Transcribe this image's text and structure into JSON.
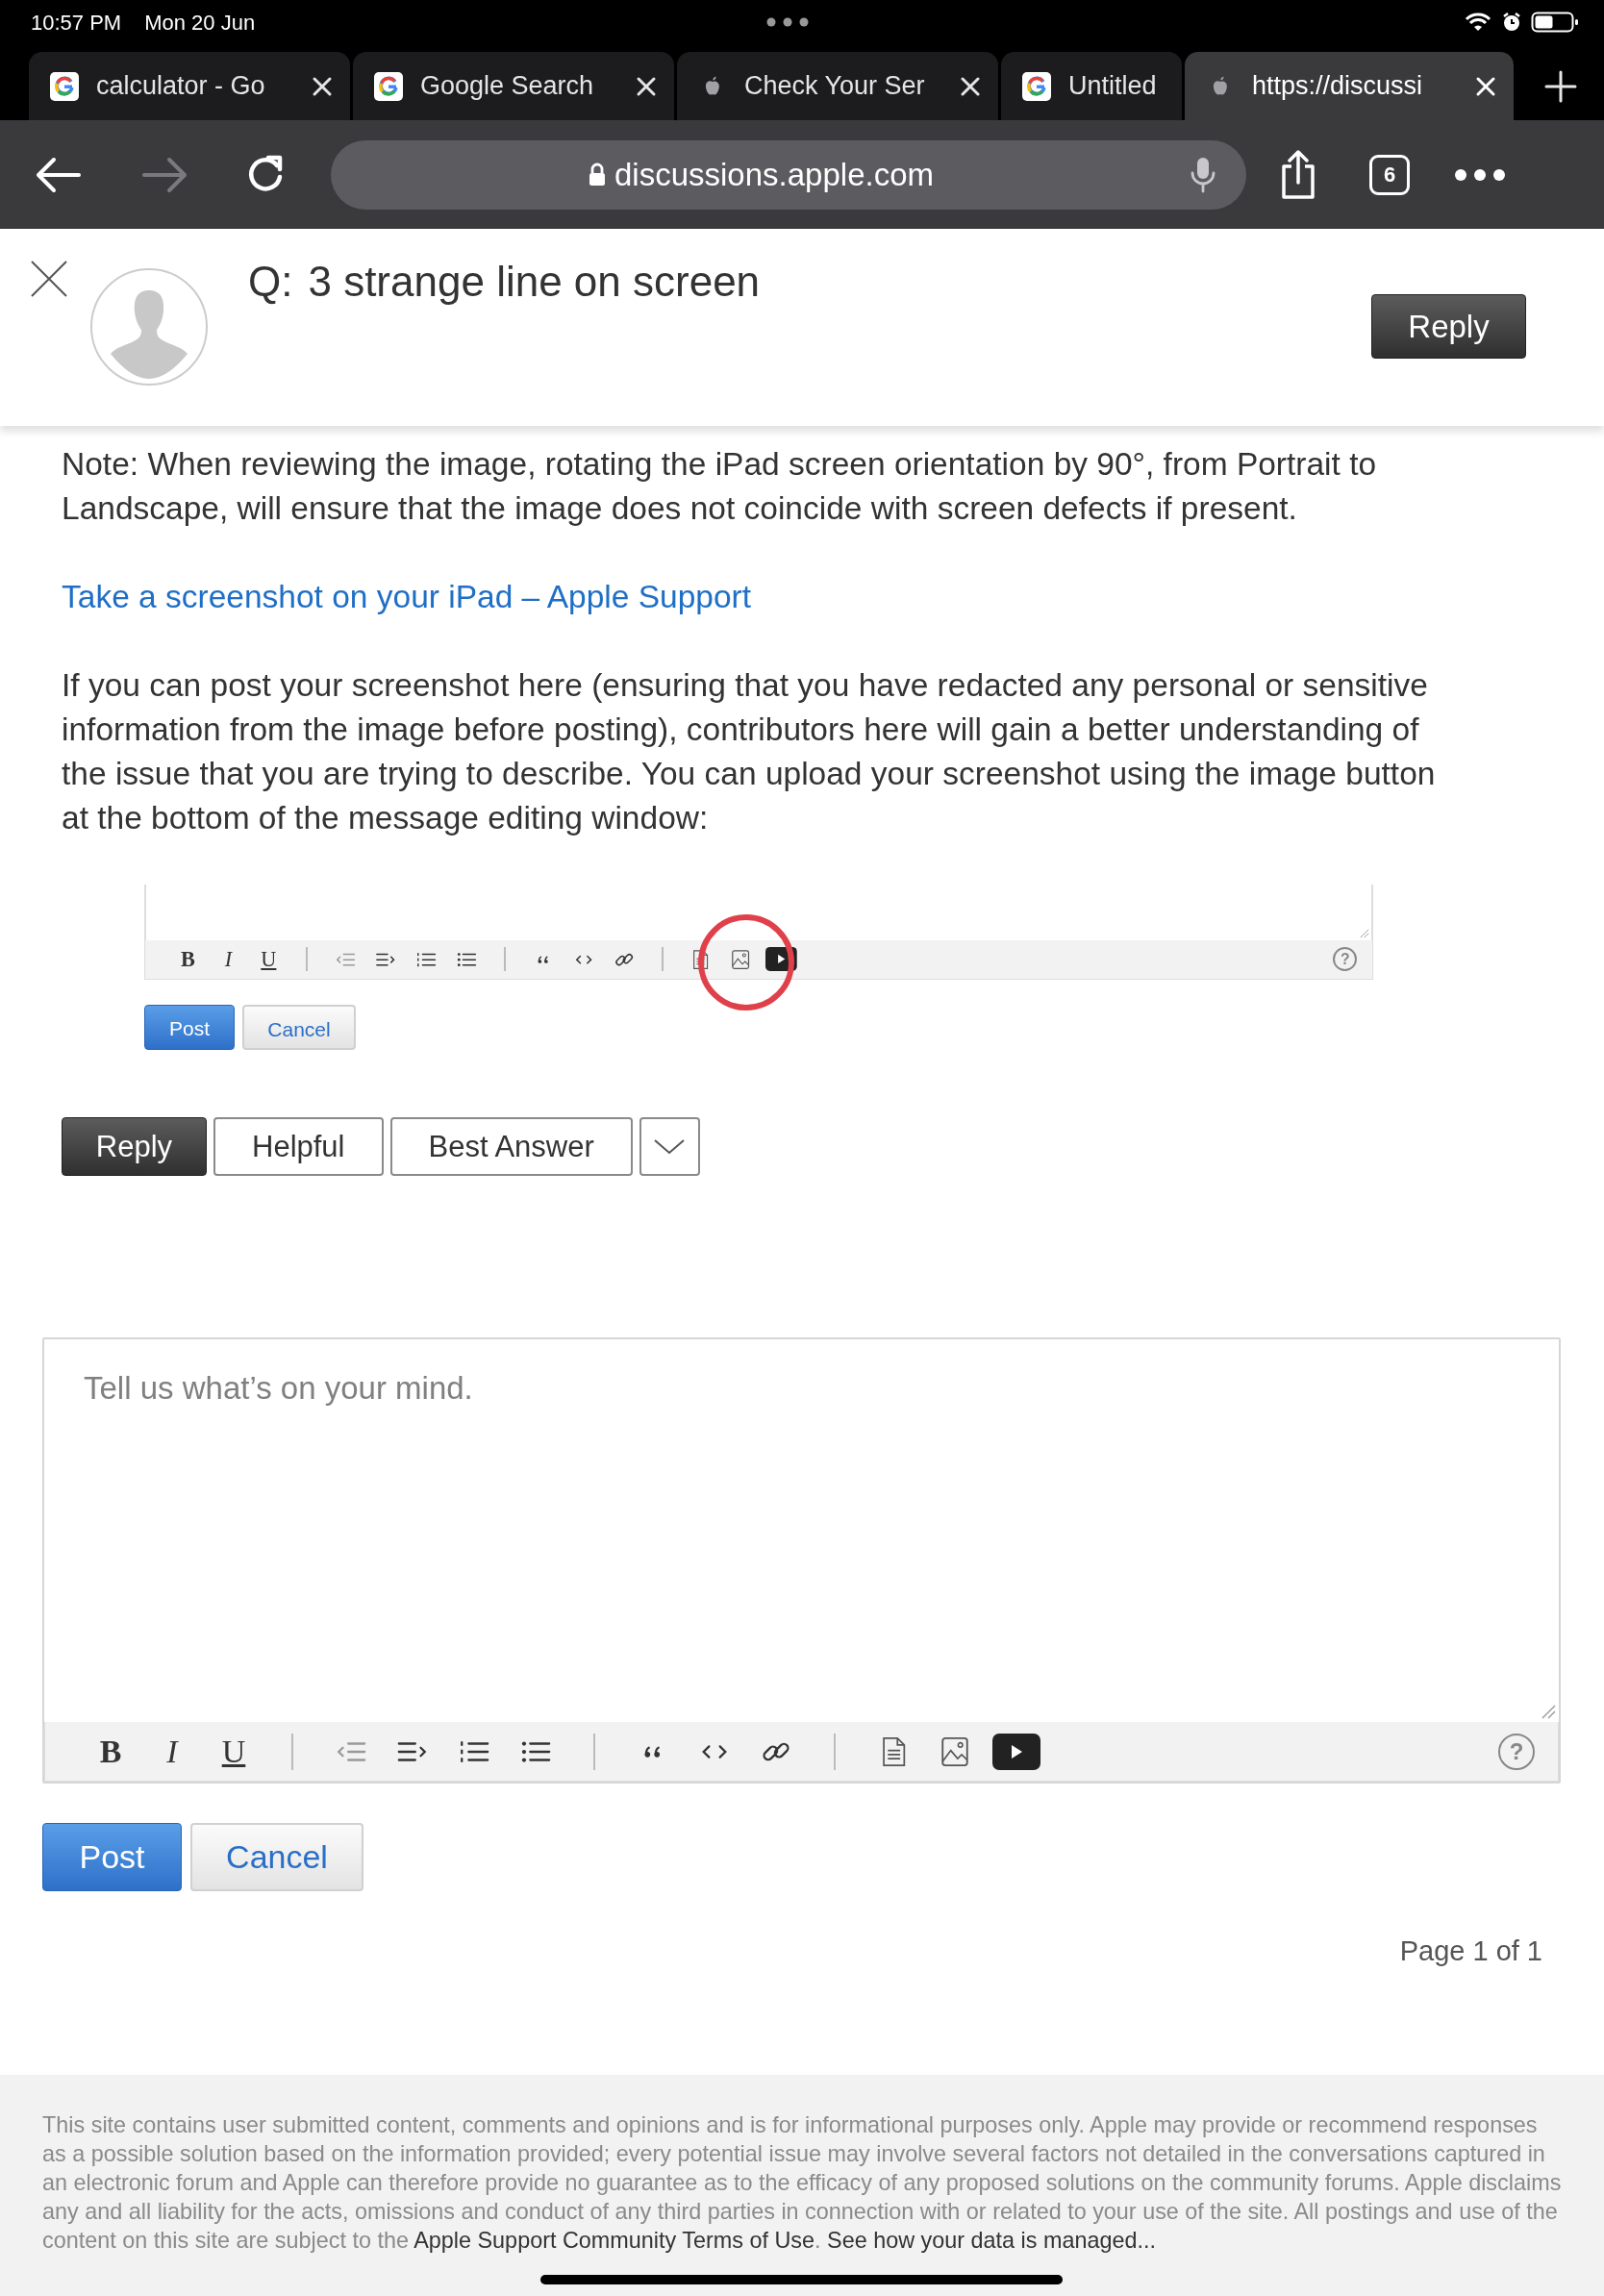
{
  "status_bar": {
    "time": "10:57 PM",
    "date": "Mon 20 Jun"
  },
  "browser_tabs": [
    {
      "title": "calculator - Go",
      "kind": "google",
      "selected": false
    },
    {
      "title": "Google Search",
      "kind": "google",
      "selected": false
    },
    {
      "title": "Check Your Ser",
      "kind": "apple",
      "selected": false
    },
    {
      "title": "Untitled",
      "kind": "google",
      "selected": false
    },
    {
      "title": "https://discussi",
      "kind": "apple",
      "selected": true
    }
  ],
  "toolbar": {
    "url": "discussions.apple.com",
    "tab_count": "6",
    "forward_disabled": true
  },
  "question": {
    "prefix": "Q:",
    "title": "3 strange line on screen",
    "reply_button": "Reply"
  },
  "post": [
    {
      "kind": "text",
      "text": "Note: When reviewing the image, rotating the iPad screen orientation by 90°, from Portrait to Landscape, will ensure that the image does not coincide with screen defects if present."
    },
    {
      "kind": "link",
      "text": "Take a screenshot on your iPad – Apple Support"
    },
    {
      "kind": "text",
      "text": "If you can post your screenshot here (ensuring that you have redacted any personal or sensitive information from the image before posting), contributors here will gain a better understanding of the issue that you are trying to describe.  You can upload your screenshot using the image button at the bottom of the message editing window:"
    }
  ],
  "embedded_screenshot": {
    "format_labels": [
      "B",
      "I",
      "U"
    ],
    "help_label": "?",
    "post_button": "Post",
    "cancel_button": "Cancel"
  },
  "actions": [
    {
      "kind": "primary",
      "label": "Reply"
    },
    {
      "kind": "plain",
      "label": "Helpful"
    },
    {
      "kind": "plain",
      "label": "Best Answer"
    },
    {
      "kind": "dropdown"
    }
  ],
  "editor": {
    "placeholder": "Tell us what’s on your mind.",
    "format_labels": [
      "B",
      "I",
      "U"
    ],
    "help_label": "?",
    "post_button": "Post",
    "cancel_button": "Cancel"
  },
  "pagination": "Page 1 of 1",
  "footer": [
    {
      "kind": "text",
      "text": "This site contains user submitted content, comments and opinions and is for informational purposes only. Apple may provide or recommend responses as a possible solution based on the information provided; every potential issue may involve several factors not detailed in the conversations captured in an electronic forum and Apple can therefore provide no guarantee as to the efficacy of any proposed solutions on the community forums. Apple disclaims any and all liability for the acts, omissions and conduct of any third parties in connection with or related to your use of the site. All postings and use of the content on this site are subject to the "
    },
    {
      "kind": "link",
      "text": "Apple Support Community Terms of Use"
    },
    {
      "kind": "text",
      "text": ". "
    },
    {
      "kind": "link",
      "text": "See how your data is managed..."
    }
  ]
}
